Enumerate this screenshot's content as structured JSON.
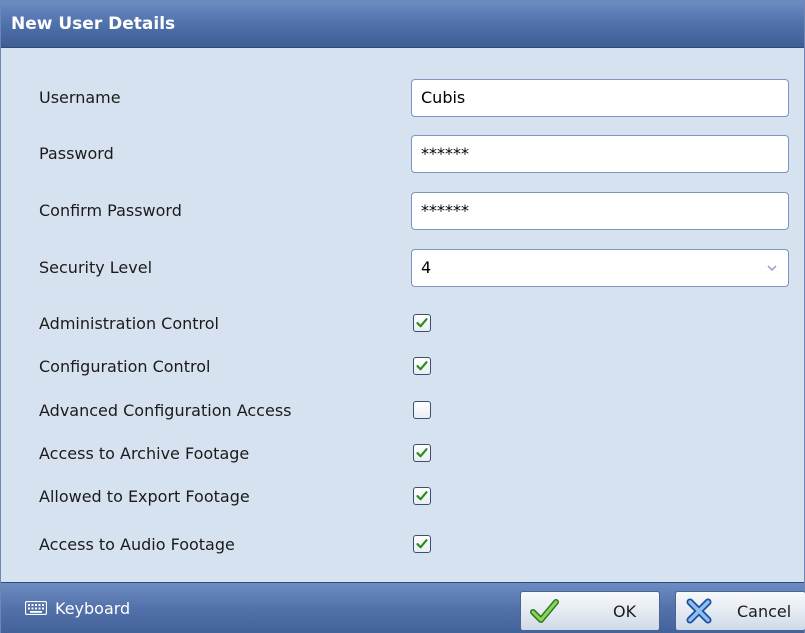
{
  "window": {
    "title": "New User Details"
  },
  "form": {
    "username": {
      "label": "Username",
      "value": "Cubis"
    },
    "password": {
      "label": "Password",
      "value": "******"
    },
    "confirm_password": {
      "label": "Confirm Password",
      "value": "******"
    },
    "security_level": {
      "label": "Security Level",
      "value": "4"
    }
  },
  "permissions": [
    {
      "label": "Administration Control",
      "checked": true
    },
    {
      "label": "Configuration Control",
      "checked": true
    },
    {
      "label": "Advanced Configuration Access",
      "checked": false
    },
    {
      "label": "Access to Archive Footage",
      "checked": true
    },
    {
      "label": "Allowed to Export Footage",
      "checked": true
    },
    {
      "label": "Access to Audio Footage",
      "checked": true
    }
  ],
  "footer": {
    "keyboard_label": "Keyboard",
    "ok_label": "OK",
    "cancel_label": "Cancel"
  },
  "colors": {
    "titlebar": "#5273ad",
    "body": "#d7e2f0",
    "check_green": "#2e8b1e",
    "cancel_blue": "#3f7fd0"
  },
  "icons": {
    "keyboard": "keyboard-icon",
    "ok": "checkmark-icon",
    "cancel": "cancel-x-icon",
    "dropdown": "chevron-down-icon"
  }
}
